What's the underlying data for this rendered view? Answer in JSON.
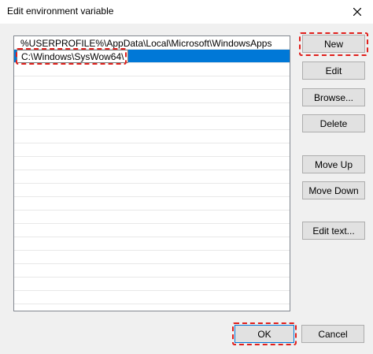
{
  "window": {
    "title": "Edit environment variable",
    "close_icon": "close-icon"
  },
  "paths": [
    "%USERPROFILE%\\AppData\\Local\\Microsoft\\WindowsApps",
    "C:\\Windows\\SysWow64\\"
  ],
  "selected_index": 1,
  "buttons": {
    "new": "New",
    "edit": "Edit",
    "browse": "Browse...",
    "delete": "Delete",
    "move_up": "Move Up",
    "move_down": "Move Down",
    "edit_text": "Edit text...",
    "ok": "OK",
    "cancel": "Cancel"
  },
  "colors": {
    "selection": "#0078d7",
    "highlight": "#e0201c",
    "button_face": "#e1e1e1"
  }
}
